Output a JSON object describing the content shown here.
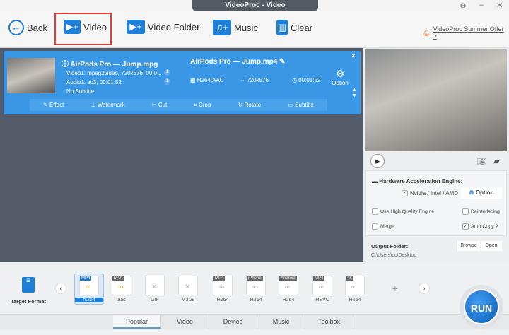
{
  "window": {
    "title": "VideoProc - Video"
  },
  "toolbar": {
    "back": "Back",
    "video": "Video",
    "video_folder": "Video Folder",
    "music": "Music",
    "clear": "Clear",
    "offer": "VideoProc Summer Offer >"
  },
  "item": {
    "source_name": "AirPods Pro — Jump.mpg",
    "video_info": "Video1: mpeg2video, 720x576, 00:0...",
    "audio_info": "Audio1: ac3, 00:01:52",
    "subtitle_info": "No Subtitle",
    "video_badge": "1",
    "audio_badge": "1",
    "output_name": "AirPods Pro — Jump.mp4",
    "codec": "H264,AAC",
    "resolution": "720x576",
    "duration": "00:01:52",
    "option": "Option",
    "codec_icon_label": "codec",
    "actions": [
      "Effect",
      "Watermark",
      "Cut",
      "Crop",
      "Rotate",
      "Subtitle"
    ]
  },
  "settings": {
    "hw_title": "Hardware Acceleration Engine:",
    "nvidia": "Nvidia / Intel / AMD",
    "option": "Option",
    "high_quality": "Use High Quality Engine",
    "deinterlacing": "Deinterlacing",
    "merge": "Merge",
    "auto_copy": "Auto Copy",
    "help": "?",
    "output_folder": "Output Folder:",
    "browse": "Browse",
    "open": "Open",
    "path": "C:\\Users\\pc\\Desktop"
  },
  "bottom": {
    "target_format": "Target Format",
    "run": "RUN",
    "formats": [
      {
        "tag": "MP4",
        "label": "h.264"
      },
      {
        "tag": "M4A",
        "label": "aac"
      },
      {
        "tag": "",
        "label": "GIF"
      },
      {
        "tag": "",
        "label": "M3U8"
      },
      {
        "tag": "MP4",
        "label": "H264"
      },
      {
        "tag": "iPhone",
        "label": "H264"
      },
      {
        "tag": "Android",
        "label": "H264"
      },
      {
        "tag": "MP4",
        "label": "HEVC"
      },
      {
        "tag": "4K",
        "label": "H264"
      }
    ],
    "tabs": [
      "Popular",
      "Video",
      "Device",
      "Music",
      "Toolbox"
    ]
  }
}
